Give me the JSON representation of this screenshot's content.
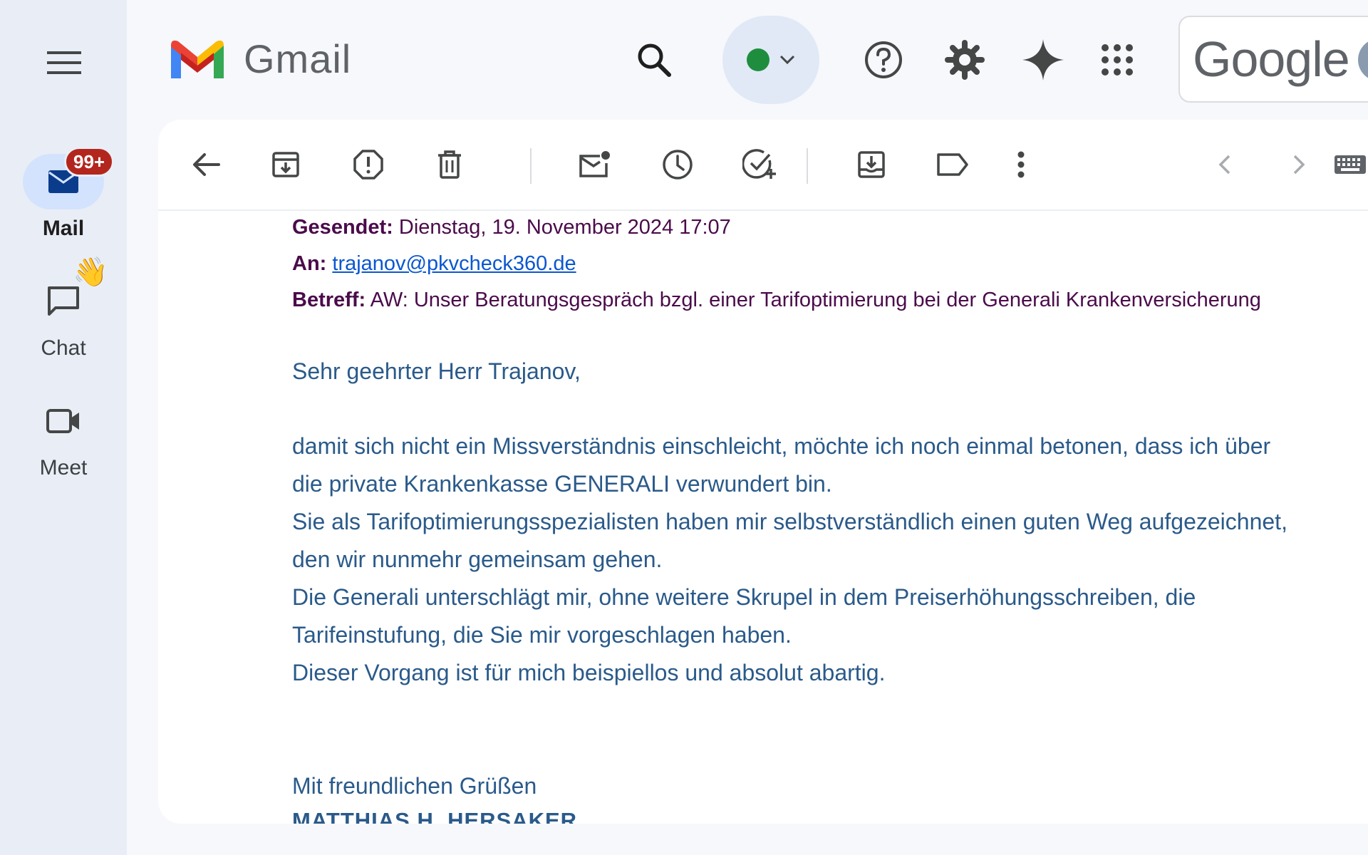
{
  "app": {
    "name": "Gmail"
  },
  "rail": {
    "items": [
      {
        "label": "Mail",
        "badge": "99+",
        "icon": "mail-icon",
        "active": true
      },
      {
        "label": "Chat",
        "icon": "chat-icon",
        "decoration": "👋"
      },
      {
        "label": "Meet",
        "icon": "video-icon"
      }
    ]
  },
  "header": {
    "brand": "Google"
  },
  "email": {
    "sent_label": "Gesendet:",
    "sent_value": "Dienstag, 19. November 2024 17:07",
    "to_label": "An:",
    "to_value": "trajanov@pkvcheck360.de",
    "subject_label": "Betreff:",
    "subject_value": "AW: Unser Beratungsgespräch bzgl. einer Tarifoptimierung bei der Generali Krankenversicherung",
    "greeting": "Sehr geehrter Herr Trajanov,",
    "body": [
      "damit sich nicht ein Missverständnis einschleicht, möchte ich noch einmal betonen, dass ich über",
      "die private Krankenkasse GENERALI verwundert bin.",
      "Sie als Tarifoptimierungsspezialisten haben mir selbstverständlich einen guten Weg aufgezeichnet,",
      "den wir nunmehr gemeinsam gehen.",
      "Die Generali unterschlägt mir, ohne weitere Skrupel in dem Preiserhöhungsschreiben, die",
      "Tarifeinstufung, die Sie mir vorgeschlagen haben.",
      "Dieser Vorgang ist für mich beispiellos und absolut abartig."
    ],
    "closing": "Mit freundlichen Grüßen",
    "signature": "MATTHIAS H. HERSAKER"
  },
  "colors": {
    "accent": "#0b57d0",
    "badge": "#b3261e",
    "status": "#1e8e3e",
    "meta_text": "#4b0b4b",
    "body_text": "#2a5a8a"
  }
}
